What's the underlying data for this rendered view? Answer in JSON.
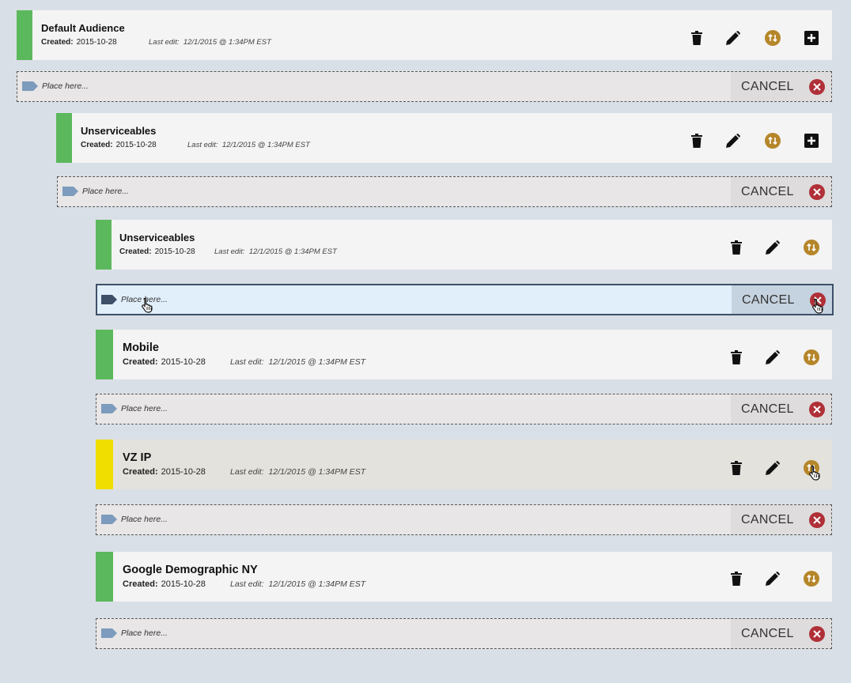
{
  "labels": {
    "created": "Created:",
    "last_edit": "Last edit:",
    "placeholder": "Place here...",
    "cancel": "CANCEL"
  },
  "colors": {
    "green": "#5cb85c",
    "yellow": "#f0de00",
    "gold": "#b5862a",
    "cancel_red": "#b03038",
    "tag": "#7c9bbd",
    "tag_active": "#3e5068"
  },
  "icons": {
    "delete": "trash-icon",
    "edit": "pencil-icon",
    "move": "swap-vertical-icon",
    "add": "plus-square-icon",
    "placeholder": "tag-icon",
    "cancel": "close-circle-icon"
  },
  "audiences": [
    {
      "name": "Default Audience",
      "created": "2015-10-28",
      "last_edit": "12/1/2015 @ 1:34PM EST",
      "status_color": "green"
    },
    {
      "name": "Unserviceables",
      "created": "2015-10-28",
      "last_edit": "12/1/2015 @ 1:34PM EST",
      "status_color": "green"
    },
    {
      "name": "Unserviceables",
      "created": "2015-10-28",
      "last_edit": "12/1/2015 @ 1:34PM EST",
      "status_color": "green"
    },
    {
      "name": "Mobile",
      "created": "2015-10-28",
      "last_edit": "12/1/2015 @ 1:34PM EST",
      "status_color": "green"
    },
    {
      "name": "VZ IP",
      "created": "2015-10-28",
      "last_edit": "12/1/2015 @ 1:34PM EST",
      "status_color": "yellow"
    },
    {
      "name": "Google Demographic NY",
      "created": "2015-10-28",
      "last_edit": "12/1/2015 @ 1:34PM EST",
      "status_color": "green"
    }
  ]
}
